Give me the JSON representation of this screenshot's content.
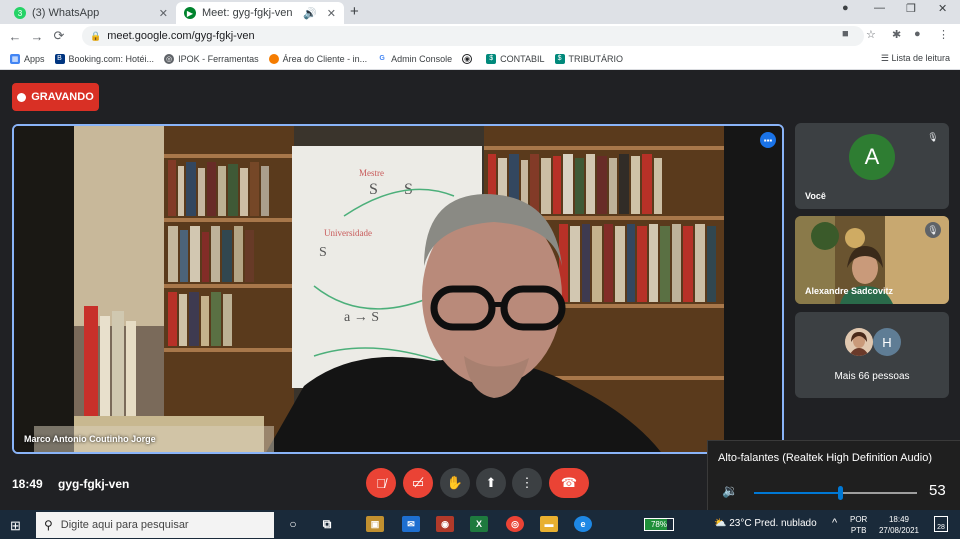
{
  "browser": {
    "tabs": [
      {
        "title": "(3) WhatsApp",
        "badge": "3",
        "active": false,
        "color": "#25d366"
      },
      {
        "title": "Meet: gyg-fgkj-ven",
        "active": true,
        "color": "#00832d"
      }
    ],
    "new_tab": "+",
    "url": "meet.google.com/gyg-fgkj-ven",
    "bookmarks": [
      {
        "label": "Apps",
        "icon": "apps-grid-icon",
        "color": "#4285f4"
      },
      {
        "label": "Booking.com: Hotéi...",
        "icon": "booking-icon",
        "color": "#003580"
      },
      {
        "label": "IPOK - Ferramentas",
        "icon": "globe-icon",
        "color": "#5f6368"
      },
      {
        "label": "Área do Cliente - in...",
        "icon": "orange-circle-icon",
        "color": "#f57c00"
      },
      {
        "label": "Admin Console",
        "icon": "google-g-icon",
        "color": "#5f6368"
      },
      {
        "label": "",
        "icon": "eye-icon",
        "color": "#202124"
      },
      {
        "label": "CONTABIL",
        "icon": "app-icon",
        "color": "#00897b"
      },
      {
        "label": "TRIBUTÁRIO",
        "icon": "app-icon",
        "color": "#00897b"
      }
    ],
    "reading_list": "Lista de leitura"
  },
  "meet": {
    "recording_label": "GRAVANDO",
    "main_speaker": "Marco Antonio Coutinho Jorge",
    "participants": [
      {
        "name": "Você",
        "initial": "A",
        "avatar_color": "#2e7d32"
      },
      {
        "name": "Alexandre Sadcovitz"
      }
    ],
    "more": {
      "label": "Mais 66 pessoas",
      "initial": "H",
      "avatar_color": "#5f7d95"
    },
    "time": "18:49",
    "meeting_code": "gyg-fgkj-ven",
    "controls": [
      "mic-off",
      "camera-off",
      "raise-hand",
      "present",
      "more-options",
      "end-call"
    ]
  },
  "volume_popup": {
    "title": "Alto-falantes (Realtek High Definition Audio)",
    "level": 53,
    "value_text": "53"
  },
  "taskbar": {
    "search_placeholder": "Digite aqui para pesquisar",
    "battery": "78%",
    "battery_level": 0.78,
    "weather": "23°C  Pred. nublado",
    "lang_line1": "POR",
    "lang_line2": "PTB",
    "clock_time": "18:49",
    "clock_date": "27/08/2021",
    "notifications": "28"
  }
}
